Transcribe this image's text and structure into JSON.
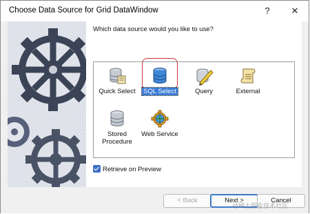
{
  "window": {
    "title": "Choose Data Source for Grid DataWindow",
    "help_label": "?",
    "close_label": "✕"
  },
  "prompt": "Which data source would you like to use?",
  "sources": [
    {
      "label": "Quick Select",
      "icon": "quick-select-icon",
      "selected": false
    },
    {
      "label": "SQL Select",
      "icon": "sql-select-icon",
      "selected": true
    },
    {
      "label": "Query",
      "icon": "query-icon",
      "selected": false
    },
    {
      "label": "External",
      "icon": "external-icon",
      "selected": false
    },
    {
      "label_line1": "Stored",
      "label_line2": "Procedure",
      "icon": "stored-procedure-icon",
      "selected": false
    },
    {
      "label": "Web Service",
      "icon": "web-service-icon",
      "selected": false
    }
  ],
  "retrieve": {
    "label": "Retrieve on Preview",
    "checked": true
  },
  "buttons": {
    "back": "< Back",
    "next": "Next >",
    "cancel": "Cancel"
  },
  "watermark": "@稀土掘金技术社区",
  "colors": {
    "selection": "#3a7bd5",
    "highlight_ring": "#c8353b",
    "checkbox": "#3f6fc6"
  }
}
